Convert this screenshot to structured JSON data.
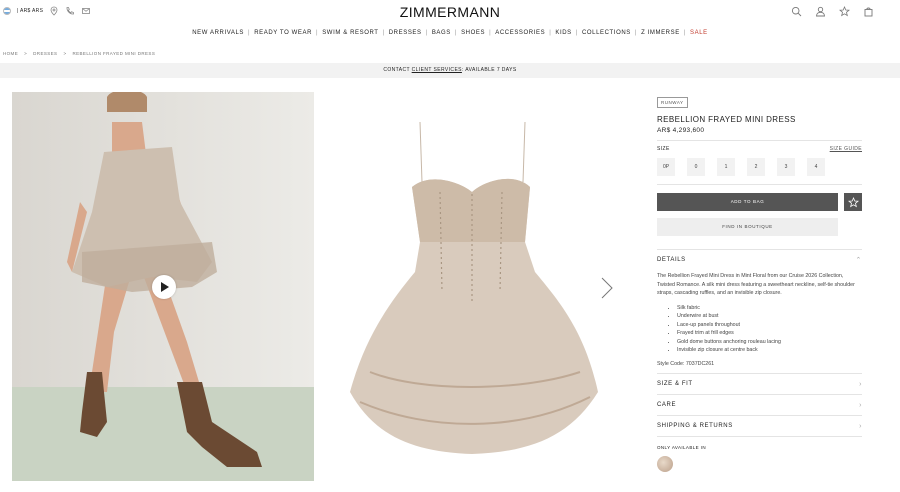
{
  "header": {
    "locale_text": "| AR$ ARS",
    "logo": "ZIMMERMANN",
    "left_icons": [
      "location-icon",
      "phone-icon",
      "mail-icon"
    ],
    "right_icons": [
      "search-icon",
      "account-icon",
      "wishlist-icon",
      "bag-icon"
    ]
  },
  "nav": {
    "items": [
      "NEW ARRIVALS",
      "READY TO WEAR",
      "SWIM & RESORT",
      "DRESSES",
      "BAGS",
      "SHOES",
      "ACCESSORIES",
      "KIDS",
      "COLLECTIONS",
      "Z IMMERSE",
      "SALE"
    ],
    "sale_color": "#c0392b"
  },
  "breadcrumb": {
    "items": [
      "HOME",
      "DRESSES",
      "REBELLION FRAYED MINI DRESS"
    ],
    "separator": ">"
  },
  "contact": {
    "prefix": "CONTACT",
    "link": "CLIENT SERVICES",
    "suffix": ": AVAILABLE 7 DAYS"
  },
  "product": {
    "badge": "RUNWAY",
    "title": "REBELLION FRAYED MINI DRESS",
    "price": "AR$ 4,293,600",
    "size_label": "SIZE",
    "size_guide": "SIZE GUIDE",
    "sizes": [
      "0P",
      "0",
      "1",
      "2",
      "3",
      "4"
    ],
    "add_to_bag": "ADD TO BAG",
    "find_in_boutique": "FIND IN BOUTIQUE",
    "details_label": "DETAILS",
    "description": "The Rebellion Frayed Mini Dress in Mint Floral from our Cruise 2026 Collection, Twisted Romance. A silk mini dress featuring a sweetheart neckline, self-tie shoulder straps, cascading ruffles, and an invisible zip closure.",
    "features": [
      "Silk fabric",
      "Underwire at bust",
      "Lace-up panels throughout",
      "Frayed trim at frill edges",
      "Gold dome buttons anchoring rouleau lacing",
      "Invisible zip closure at centre back"
    ],
    "style_code": "Style Code: 7037DC261",
    "sections": [
      "SIZE & FIT",
      "CARE",
      "SHIPPING & RETURNS"
    ],
    "only_available": "ONLY AVAILABLE IN",
    "accent_button_color": "#555555"
  }
}
